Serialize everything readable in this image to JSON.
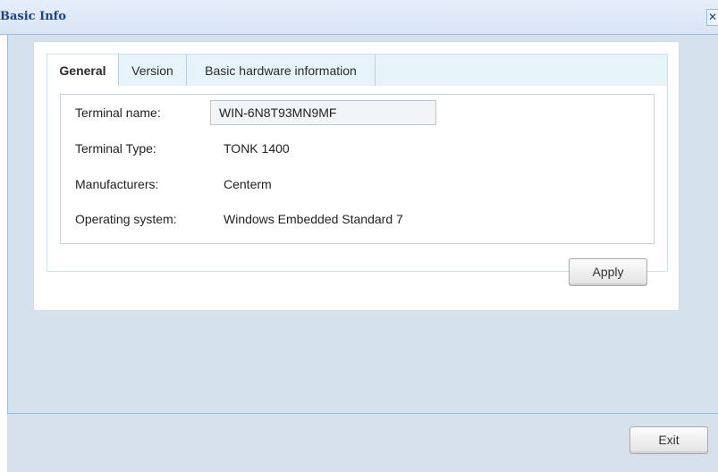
{
  "window": {
    "title": "Basic Info",
    "close_glyph": "✕"
  },
  "tabs": [
    {
      "label": "General",
      "active": true
    },
    {
      "label": "Version",
      "active": false
    },
    {
      "label": "Basic hardware information",
      "active": false
    }
  ],
  "general": {
    "terminal_name_label": "Terminal name:",
    "terminal_name_value": "WIN-6N8T93MN9MF",
    "terminal_type_label": "Terminal Type:",
    "terminal_type_value": "TONK 1400",
    "manufacturers_label": "Manufacturers:",
    "manufacturers_value": "Centerm",
    "os_label": "Operating system:",
    "os_value": "Windows Embedded Standard 7"
  },
  "buttons": {
    "apply": "Apply",
    "exit": "Exit"
  },
  "colors": {
    "title_text": "#15428b",
    "body_background": "#d6e1ee",
    "tab_strip": "#e6f3f9"
  }
}
